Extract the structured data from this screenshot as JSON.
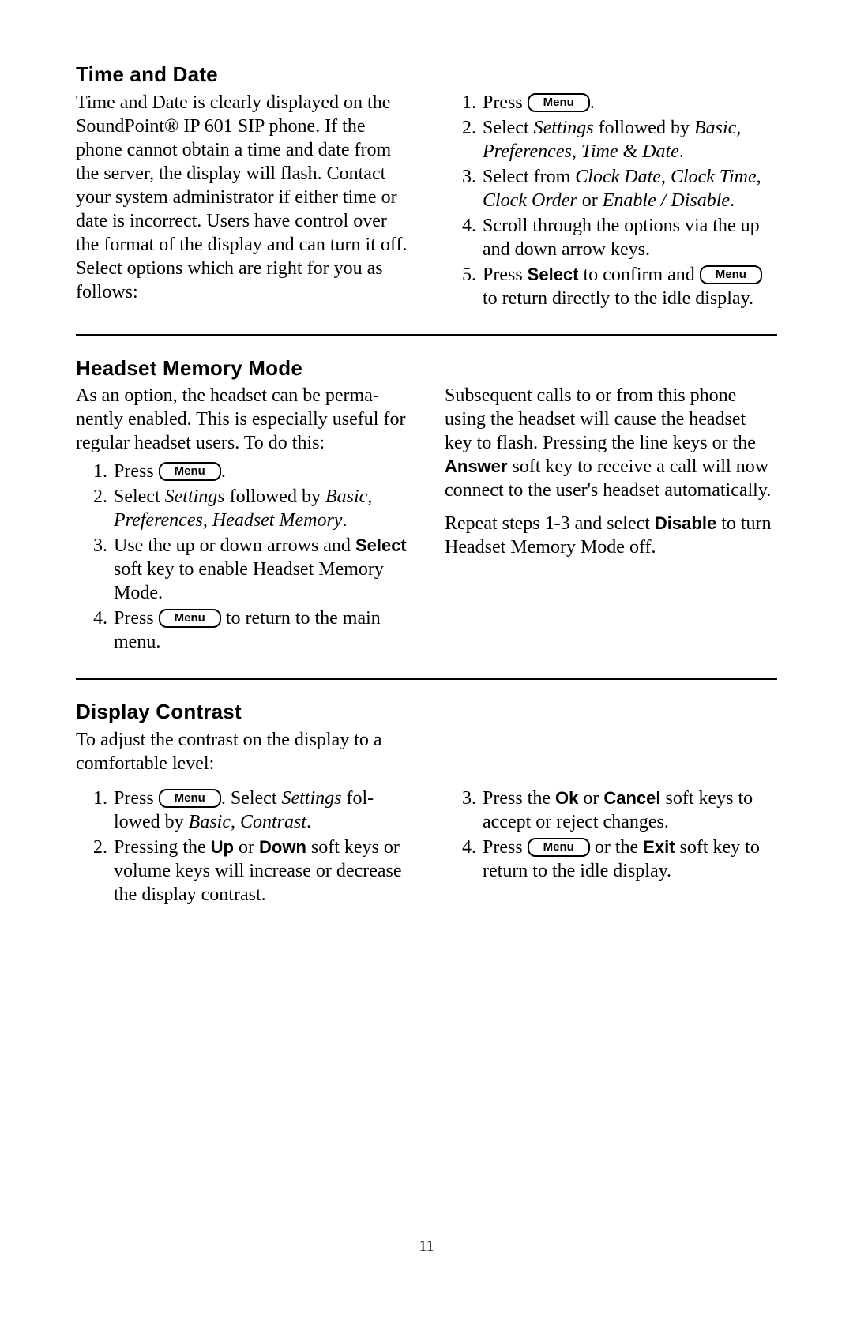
{
  "menuLabel": "Menu",
  "pageNumber": "11",
  "s1": {
    "heading": "Time and Date",
    "intro": "Time and Date is clearly displayed on the SoundPoint® IP 601 SIP phone.  If the phone cannot obtain a time and date from the server, the display will flash.  Contact your system administrator if either time or date is incorrect.  Users have control over the format of the display and can turn it off.  Select options which are right for you as follows:",
    "st1a": "Press ",
    "st1b": ".",
    "st2a": "Select ",
    "st2b": "Settings",
    "st2c": " followed by ",
    "st2d": "Basic, Preferences, Time & Date",
    "st2e": ".",
    "st3a": "Select from ",
    "st3b": "Clock Date",
    "st3c": ", ",
    "st3d": "Clock Time",
    "st3e": ", ",
    "st3f": "Clock Order",
    "st3g": " or ",
    "st3h": "Enable / Disable",
    "st3i": ".",
    "st4": "Scroll through the options via the up and down arrow keys.",
    "st5a": "Press ",
    "st5b": "Select",
    "st5c": " to confirm and ",
    "st5d": " to return directly to the idle display."
  },
  "s2": {
    "heading": "Headset Memory Mode",
    "intro": "As an option, the headset can be perma­nently enabled.  This is especially useful for regular headset users.  To do this:",
    "st1a": "Press ",
    "st1b": ".",
    "st2a": "Select ",
    "st2b": "Settings",
    "st2c": " followed by ",
    "st2d": "Basic, Preferences, Headset Memory",
    "st2e": ".",
    "st3a": "Use the up or down arrows and ",
    "st3b": "Select",
    "st3c": " soft key to enable Headset Memory Mode.",
    "st4a": "Press ",
    "st4b": " to return to the main menu.",
    "p2a": "Subsequent calls to or from this phone using the headset will cause the headset key to flash.  Pressing the line keys or the ",
    "p2b": "Answer",
    "p2c": " soft key to receive a call will now connect to the user's headset automati­cally.",
    "p3a": "Repeat steps 1-3 and select ",
    "p3b": "Disable",
    "p3c": " to turn Headset Memory Mode off."
  },
  "s3": {
    "heading": "Display Contrast",
    "intro": "To adjust the contrast on the display to a comfortable level:",
    "st1a": "Press ",
    "st1b": ".  Select ",
    "st1c": "Settings",
    "st1d": " fol­lowed by ",
    "st1e": "Basic, Contrast",
    "st1f": ".",
    "st2a": "Pressing the ",
    "st2b": "Up",
    "st2c": " or ",
    "st2d": "Down",
    "st2e": " soft keys or volume keys will increase or decrease the display contrast.",
    "st3a": "Press the ",
    "st3b": "Ok",
    "st3c": " or ",
    "st3d": "Cancel",
    "st3e": " soft keys to accept or reject changes.",
    "st4a": "Press ",
    "st4b": " or the ",
    "st4c": "Exit",
    "st4d": " soft key to return to the idle display."
  }
}
